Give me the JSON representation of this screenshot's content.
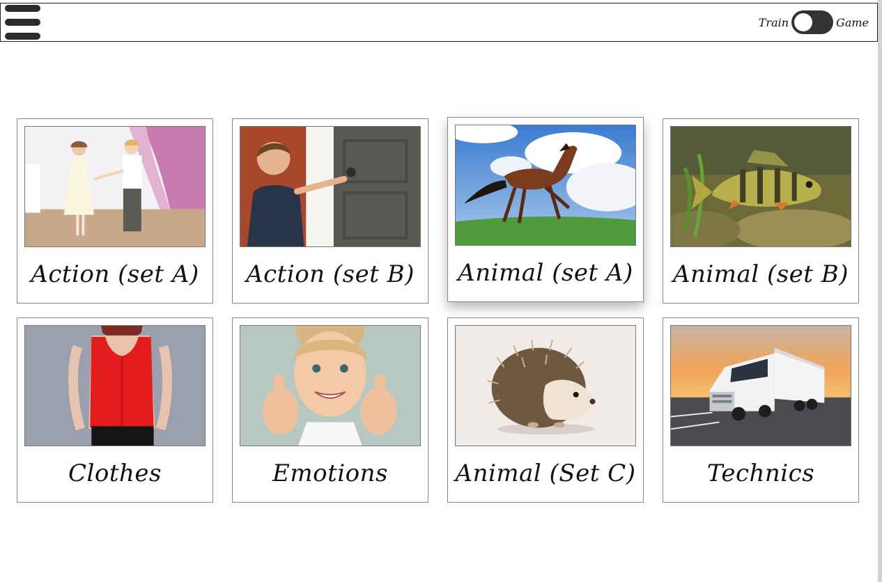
{
  "header": {
    "menu_icon": "hamburger-menu-icon",
    "toggle": {
      "left_label": "Train",
      "right_label": "Game"
    }
  },
  "categories": [
    {
      "label": "Action (set A)",
      "image": "children-dancing"
    },
    {
      "label": "Action (set B)",
      "image": "boy-opening-door"
    },
    {
      "label": "Animal (set A)",
      "image": "horse-running"
    },
    {
      "label": "Animal (set B)",
      "image": "fish-perch"
    },
    {
      "label": "Clothes",
      "image": "red-blouse"
    },
    {
      "label": "Emotions",
      "image": "girl-thumbs-up"
    },
    {
      "label": "Animal (Set C)",
      "image": "hedgehog"
    },
    {
      "label": "Technics",
      "image": "truck"
    }
  ],
  "colors": {
    "text": "#111111",
    "border": "#888888",
    "toggle_track": "#333333"
  }
}
